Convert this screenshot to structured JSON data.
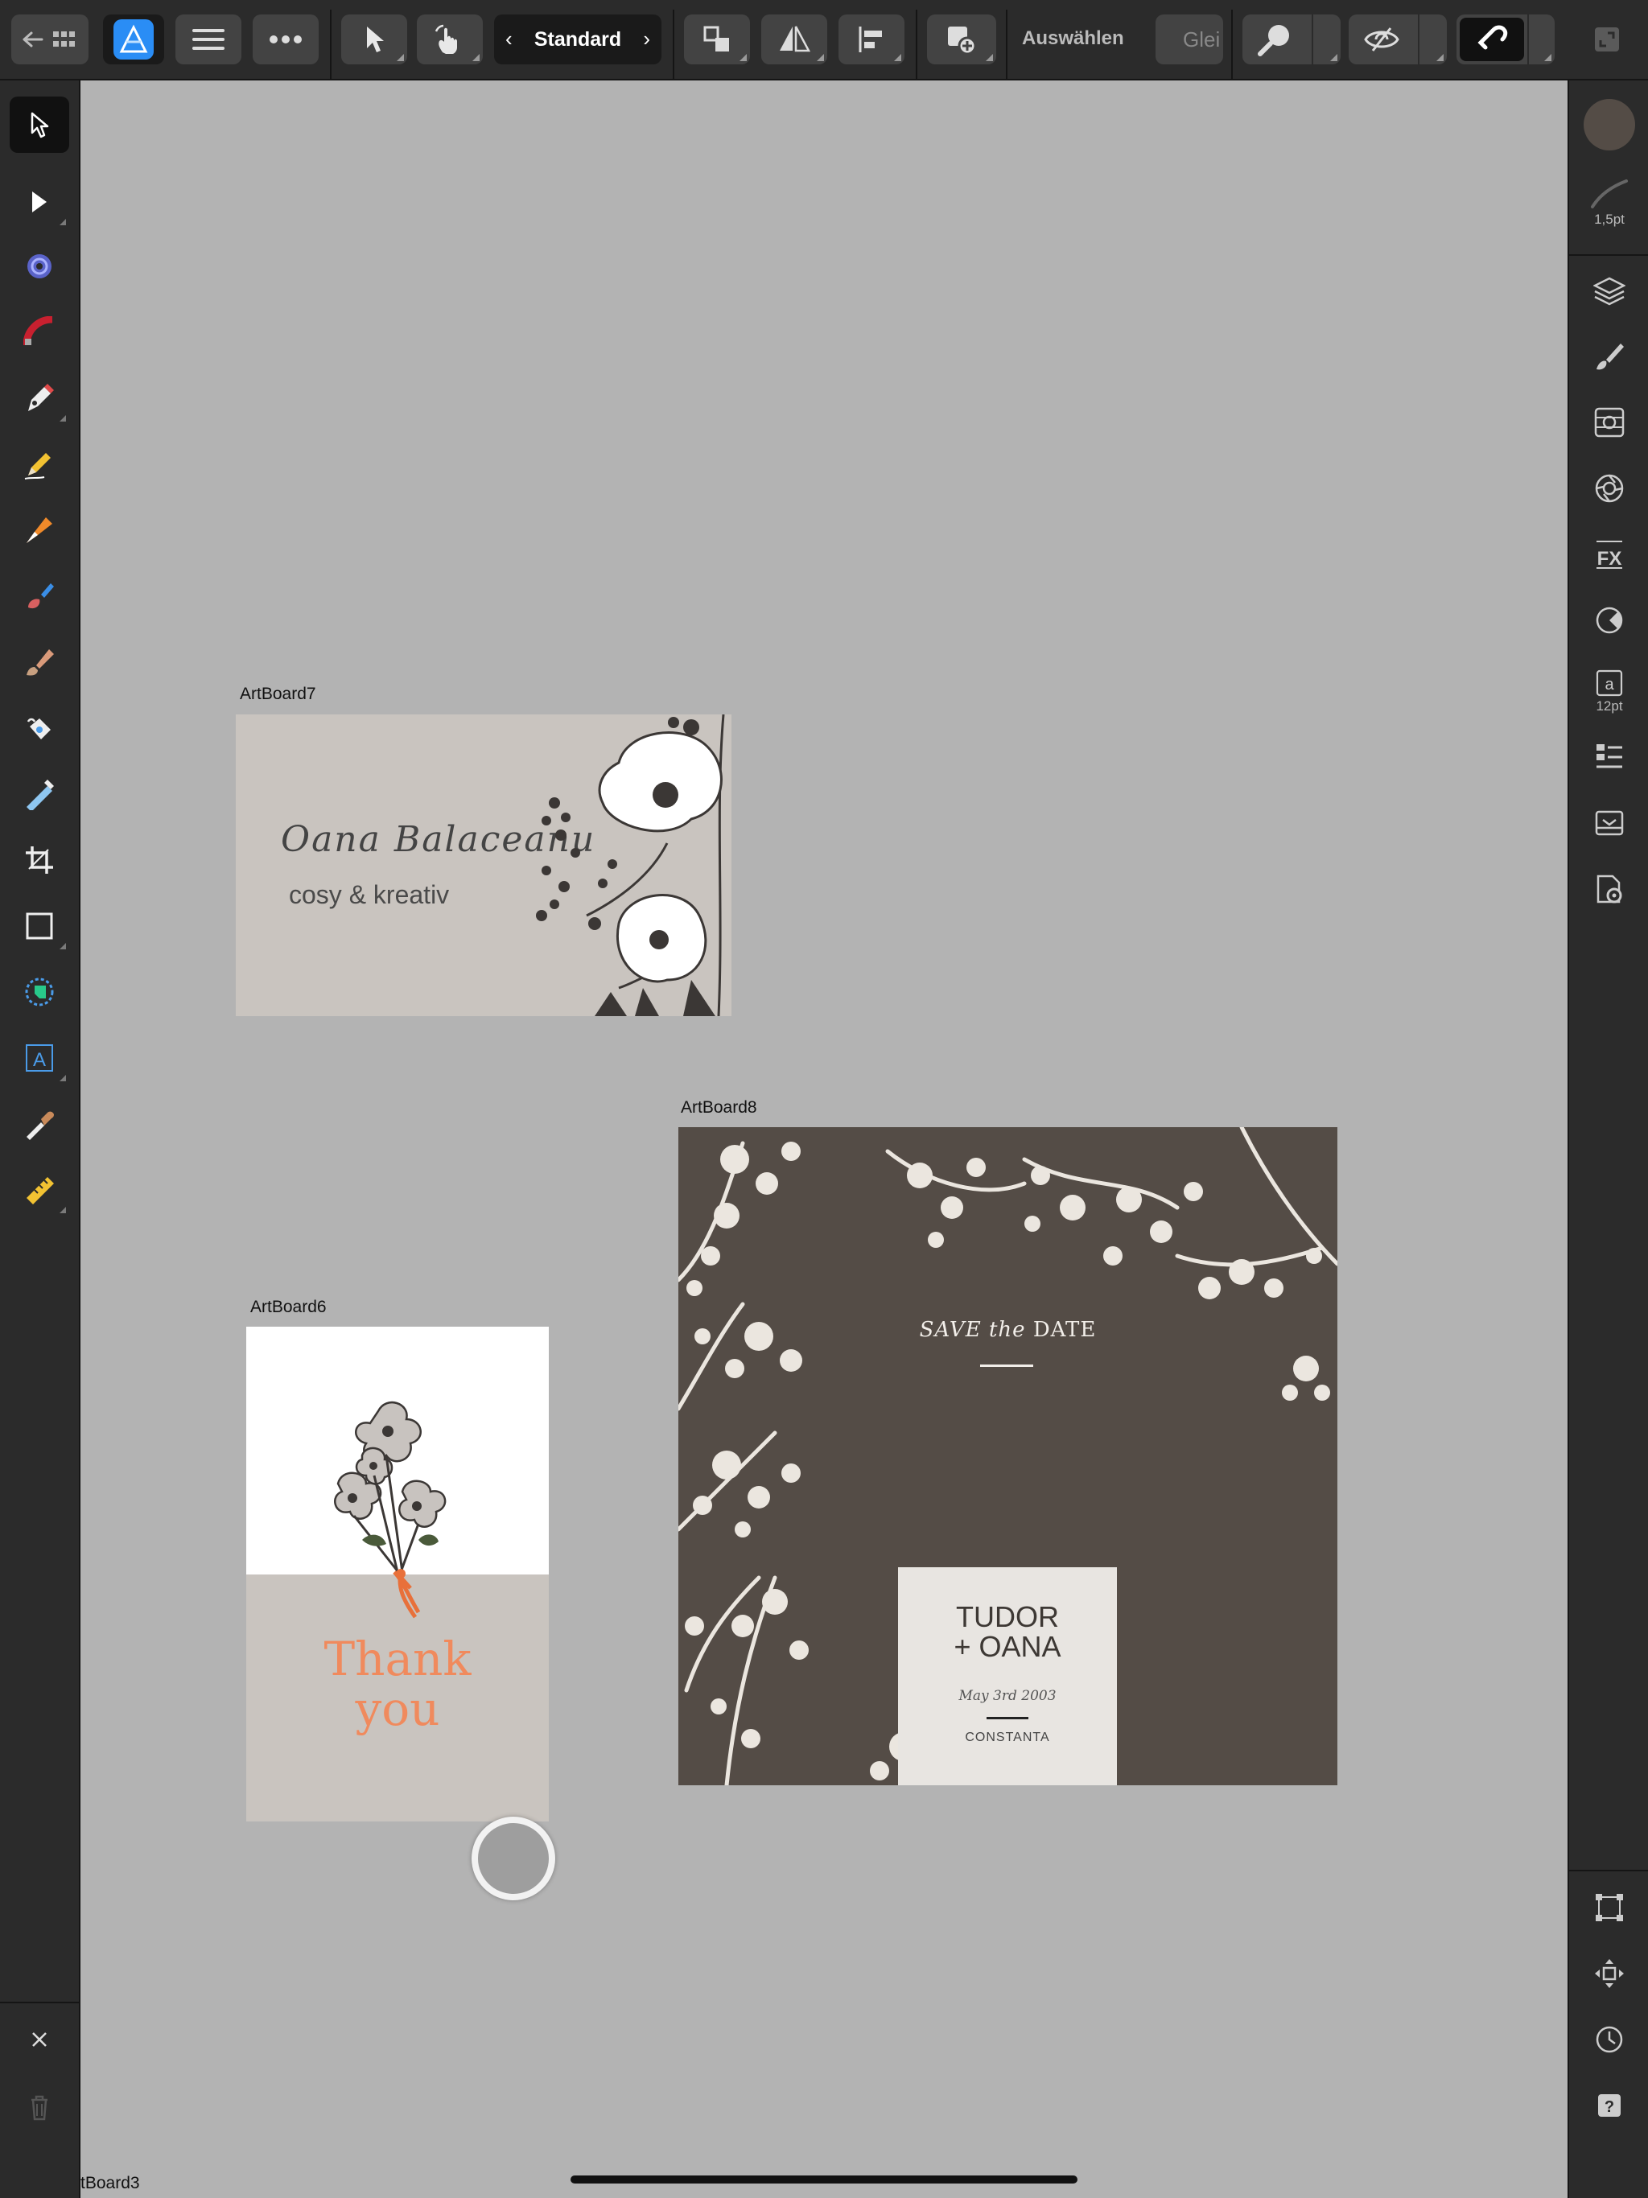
{
  "toolbar": {
    "mode_label": "Standard",
    "select_label": "Auswählen",
    "gleich_label": "Glei"
  },
  "stroke_panel": {
    "width_label": "1,5pt"
  },
  "text_panel": {
    "size_label": "12pt"
  },
  "artboards": {
    "ab7": {
      "label": "ArtBoard7",
      "script": "Oana Balaceanu",
      "tagline": "cosy & kreativ"
    },
    "ab8": {
      "label": "ArtBoard8",
      "save_the": "SAVE the",
      "date_word": "DATE",
      "names_line1": "TUDOR",
      "names_line2": "+ OANA",
      "date": "May 3rd 2003",
      "place": "CONSTANTA"
    },
    "ab6": {
      "label": "ArtBoard6",
      "thank": "Thank",
      "you": "you"
    },
    "ab3": {
      "label": "tBoard3"
    }
  },
  "colors": {
    "accent_blue": "#2a8df5",
    "canvas_bg": "#b3b3b3",
    "card_brown": "#544c46",
    "card_beige": "#c9c4bf",
    "thank_orange": "#f08a5d"
  }
}
